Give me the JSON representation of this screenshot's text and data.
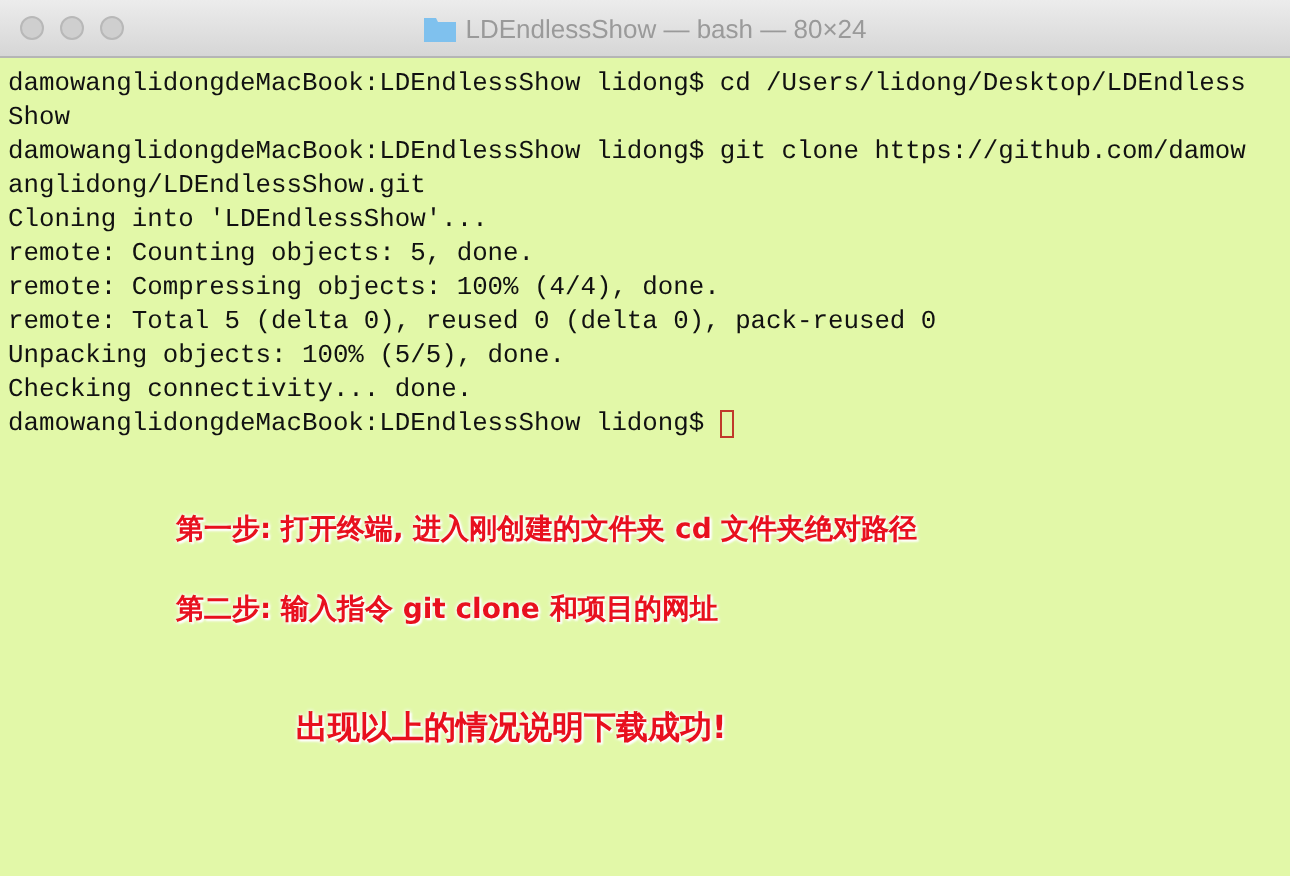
{
  "window": {
    "title": "LDEndlessShow — bash — 80×24"
  },
  "terminal": {
    "lines": [
      "damowanglidongdeMacBook:LDEndlessShow lidong$ cd /Users/lidong/Desktop/LDEndless",
      "Show",
      "damowanglidongdeMacBook:LDEndlessShow lidong$ git clone https://github.com/damow",
      "anglidong/LDEndlessShow.git",
      "Cloning into 'LDEndlessShow'...",
      "remote: Counting objects: 5, done.",
      "remote: Compressing objects: 100% (4/4), done.",
      "remote: Total 5 (delta 0), reused 0 (delta 0), pack-reused 0",
      "Unpacking objects: 100% (5/5), done.",
      "Checking connectivity... done."
    ],
    "prompt": "damowanglidongdeMacBook:LDEndlessShow lidong$"
  },
  "annotations": [
    {
      "text": "第一步: 打开终端, 进入刚创建的文件夹  cd  文件夹绝对路径",
      "kind": "step"
    },
    {
      "text": "第二步: 输入指令  git clone 和项目的网址",
      "kind": "step"
    },
    {
      "text": "出现以上的情况说明下载成功!",
      "kind": "result"
    }
  ]
}
